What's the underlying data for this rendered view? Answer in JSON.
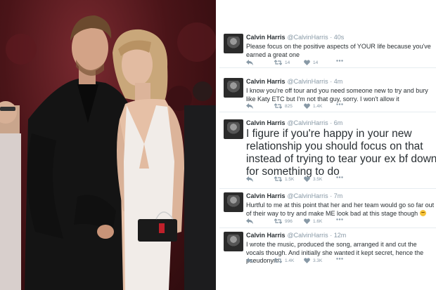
{
  "tweets": [
    {
      "name": "Calvin Harris",
      "handle": "@CalvinHarris",
      "time": "40s",
      "text": "Please focus on the positive aspects of YOUR life because you've earned a great one",
      "retweets": "14",
      "likes": "14",
      "large": false
    },
    {
      "name": "Calvin Harris",
      "handle": "@CalvinHarris",
      "time": "4m",
      "text": "I know you're off tour and you need someone new to try and bury like Katy ETC but I'm not that guy, sorry. I won't allow it",
      "retweets": "825",
      "likes": "1.4K",
      "large": false
    },
    {
      "name": "Calvin Harris",
      "handle": "@CalvinHarris",
      "time": "6m",
      "text": "I figure if you're happy in your new relationship you should focus on that instead of trying to tear your ex bf down for something to do",
      "retweets": "1.5K",
      "likes": "3.5K",
      "large": true
    },
    {
      "name": "Calvin Harris",
      "handle": "@CalvinHarris",
      "time": "7m",
      "text": "Hurtful to me at this point that her and her team would go so far out of their way to try and make ME look bad at this stage though",
      "retweets": "996",
      "likes": "1.6K",
      "large": false,
      "emoji": "thinking-face-emoji"
    },
    {
      "name": "Calvin Harris",
      "handle": "@CalvinHarris",
      "time": "12m",
      "text": "I wrote the music, produced the song, arranged it and cut the vocals though. And initially she wanted it kept secret, hence the pseudonym",
      "retweets": "1.4K",
      "likes": "3.3K",
      "large": false
    }
  ],
  "icons": {
    "reply": "reply-icon",
    "retweet": "retweet-icon",
    "like": "heart-icon",
    "more": "more-icon"
  },
  "colors": {
    "text": "#292f33",
    "muted": "#8899a6",
    "divider": "#e6ecf0",
    "photo_background": "#4a1418"
  }
}
